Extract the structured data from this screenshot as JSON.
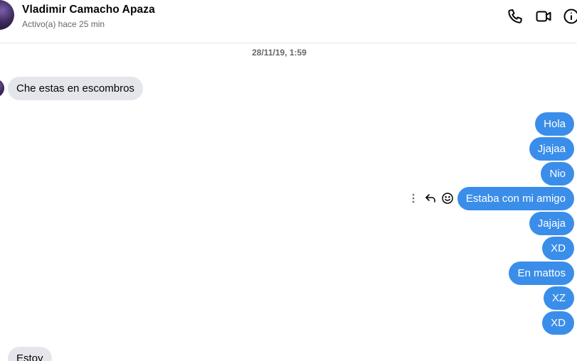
{
  "header": {
    "contact_name": "Vladimir Camacho Apaza",
    "status": "Activo(a) hace 25 min",
    "icons": [
      "phone-icon",
      "video-camera-icon",
      "info-icon"
    ]
  },
  "conversation": {
    "timestamp": "28/11/19, 1:59",
    "messages": [
      {
        "direction": "incoming",
        "text": "Che estas en escombros"
      },
      {
        "direction": "outgoing",
        "text": "Hola"
      },
      {
        "direction": "outgoing",
        "text": "Jjajaa"
      },
      {
        "direction": "outgoing",
        "text": "Nio"
      },
      {
        "direction": "outgoing",
        "text": "Estaba con mi amigo"
      },
      {
        "direction": "outgoing",
        "text": "Jajaja"
      },
      {
        "direction": "outgoing",
        "text": "XD"
      },
      {
        "direction": "outgoing",
        "text": "En mattos"
      },
      {
        "direction": "outgoing",
        "text": "XZ"
      },
      {
        "direction": "outgoing",
        "text": "XD"
      },
      {
        "direction": "incoming",
        "text": "Estoy"
      }
    ],
    "hover_actions": [
      "more-options-icon",
      "reply-icon",
      "react-emoji-icon"
    ]
  },
  "colors": {
    "outgoing_bubble": "#3a8eea",
    "incoming_bubble": "#e4e6eb",
    "secondary_text": "#65676b"
  }
}
